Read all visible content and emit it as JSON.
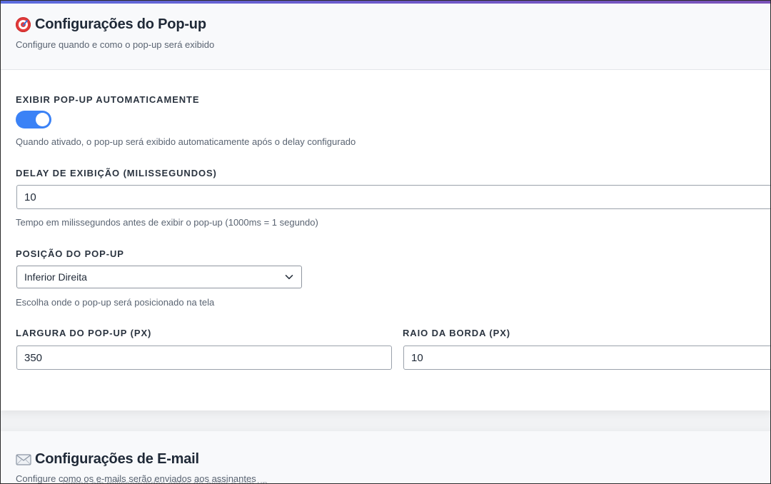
{
  "popup_section": {
    "title": "Configurações do Pop-up",
    "subtitle": "Configure quando e como o pop-up será exibido",
    "auto_show": {
      "label": "EXIBIR POP-UP AUTOMATICAMENTE",
      "enabled": true,
      "help": "Quando ativado, o pop-up será exibido automaticamente após o delay configurado"
    },
    "delay": {
      "label": "DELAY DE EXIBIÇÃO (MILISSEGUNDOS)",
      "value": "10",
      "help": "Tempo em milissegundos antes de exibir o pop-up (1000ms = 1 segundo)"
    },
    "position": {
      "label": "POSIÇÃO DO POP-UP",
      "selected": "Inferior Direita",
      "help": "Escolha onde o pop-up será posicionado na tela"
    },
    "width": {
      "label": "LARGURA DO POP-UP (PX)",
      "value": "350"
    },
    "radius": {
      "label": "RAIO DA BORDA (PX)",
      "value": "10"
    }
  },
  "email_section": {
    "title": "Configurações de E-mail",
    "subtitle": "Configure como os e-mails serão enviados aos assinantes"
  },
  "ghost_text": "Tempo em milissegundos antes de exibir o pop-up",
  "icons": {
    "popup_title": "target-icon",
    "email_title": "envelope-icon",
    "select": "chevron-down-icon"
  },
  "colors": {
    "accent": "#3b82f6",
    "top_bar_start": "#5b6cde",
    "top_bar_end": "#7a52b8"
  }
}
